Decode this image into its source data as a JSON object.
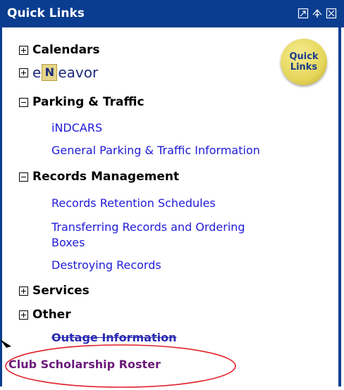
{
  "panel": {
    "title": "Quick Links",
    "header_icons": [
      "restore-icon",
      "collapse-up-icon",
      "close-icon"
    ]
  },
  "badge": {
    "line1": "Quick",
    "line2": "Links"
  },
  "categories": {
    "calendars": {
      "label": "Calendars",
      "state": "collapsed"
    },
    "endeavor": {
      "prefix": "e",
      "logo": "N",
      "suffix": "eavor",
      "state": "collapsed"
    },
    "parking": {
      "label": "Parking & Traffic",
      "state": "expanded",
      "links": [
        "iNDCARS",
        "General Parking & Traffic Information"
      ]
    },
    "records": {
      "label": "Records Management",
      "state": "expanded",
      "links": [
        "Records Retention Schedules",
        "Transferring Records and Ordering",
        "Boxes",
        "Destroying Records"
      ]
    },
    "services": {
      "label": "Services",
      "state": "collapsed"
    },
    "other": {
      "label": "Other",
      "state": "collapsed"
    }
  },
  "bottom_links": {
    "outage": "Outage Information",
    "club": "Club Scholarship Roster"
  },
  "colors": {
    "header_bg": "#0a3d8f",
    "link": "#1f1bd6",
    "annotation": "#e0202a"
  }
}
